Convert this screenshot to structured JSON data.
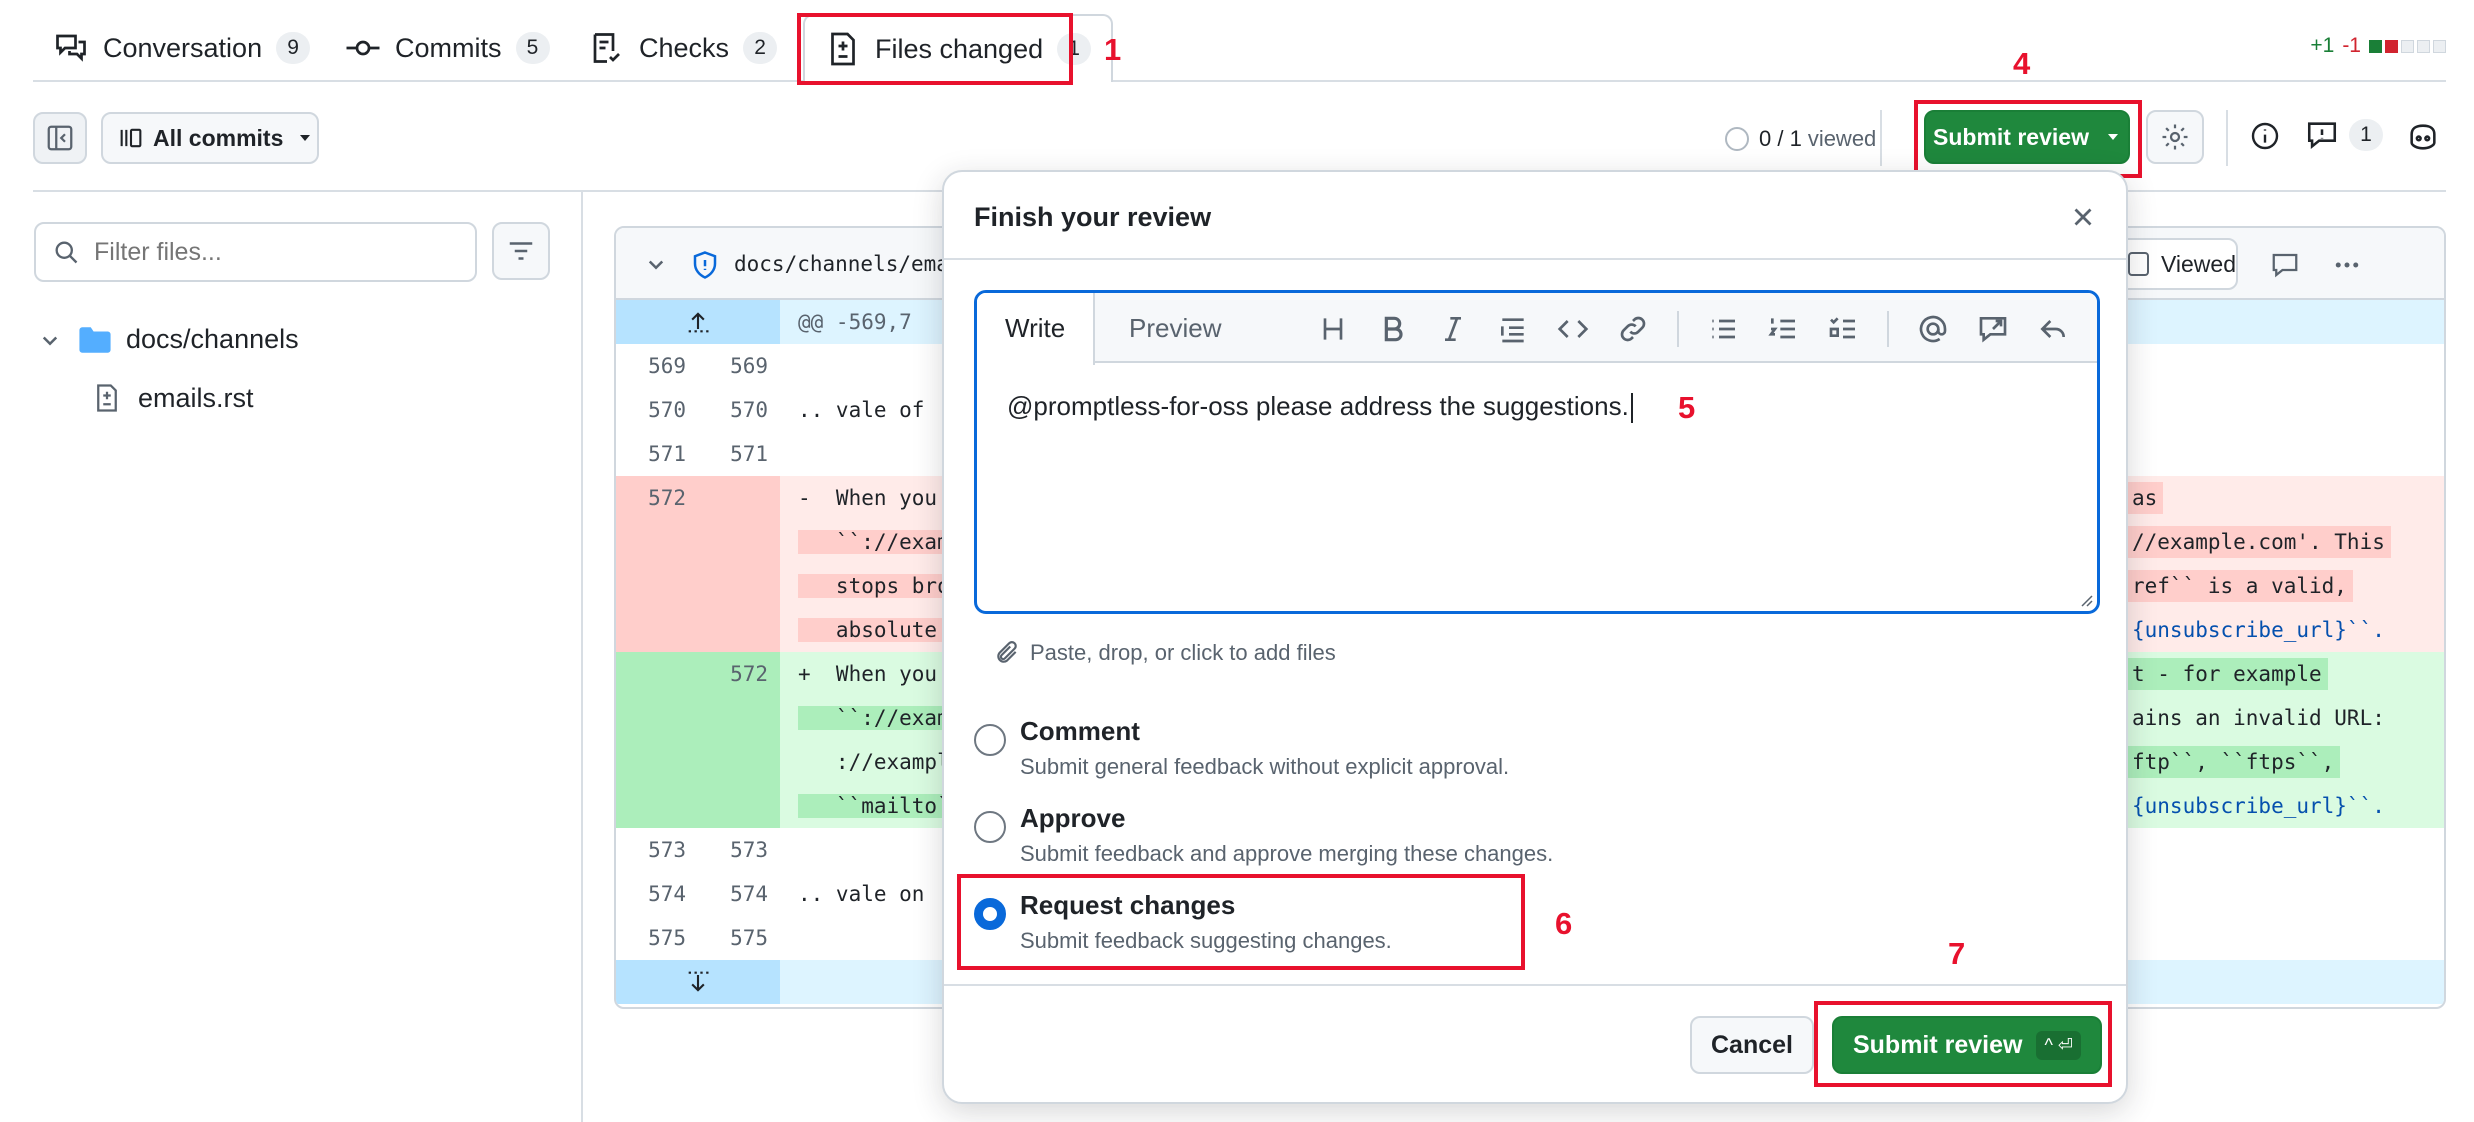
{
  "tabs": [
    {
      "label": "Conversation",
      "count": "9",
      "icon": "comment-discussion-icon"
    },
    {
      "label": "Commits",
      "count": "5",
      "icon": "git-commit-icon"
    },
    {
      "label": "Checks",
      "count": "2",
      "icon": "checklist-icon"
    },
    {
      "label": "Files changed",
      "count": "1",
      "icon": "file-diff-icon",
      "active": true
    }
  ],
  "diffstat": {
    "added": "+1",
    "removed": "-1"
  },
  "toolbar": {
    "commits_select": "All commits",
    "viewed": "0 / 1",
    "viewed_label": "viewed",
    "submit_review": "Submit review",
    "comments_count": "1"
  },
  "sidebar": {
    "filter_placeholder": "Filter files...",
    "folder": "docs/channels",
    "file": "emails.rst"
  },
  "diff": {
    "file_path": "docs/channels/emai",
    "viewed_label": "Viewed",
    "hunk_header": "@@ -569,7",
    "lines": [
      {
        "old": "569",
        "new": "569",
        "left": "",
        "right": ""
      },
      {
        "old": "570",
        "new": "570",
        "left": ".. vale of",
        "right": ""
      },
      {
        "old": "571",
        "new": "571",
        "left": "",
        "right": ""
      },
      {
        "old": "572",
        "new": "",
        "left": "-  When you s",
        "right": "as"
      },
      {
        "old": "",
        "new": "",
        "left": "   ``://examp",
        "right": "//example.com'. This"
      },
      {
        "old": "",
        "new": "",
        "left": "   stops brok",
        "right": "ref`` is a valid,"
      },
      {
        "old": "",
        "new": "",
        "left": "   absolute U",
        "right": "{unsubscribe_url}``."
      },
      {
        "old": "",
        "new": "572",
        "left": "+  When you s",
        "right": "t - for example"
      },
      {
        "old": "",
        "new": "",
        "left": "   ``://examp",
        "right": "ains an invalid URL:"
      },
      {
        "old": "",
        "new": "",
        "left": "   ://example",
        "right": "ftp``, ``ftps``,"
      },
      {
        "old": "",
        "new": "",
        "left": "   ``mailto``",
        "right": "{unsubscribe_url}``."
      },
      {
        "old": "573",
        "new": "573",
        "left": "",
        "right": ""
      },
      {
        "old": "574",
        "new": "574",
        "left": ".. vale on",
        "right": ""
      },
      {
        "old": "575",
        "new": "575",
        "left": "",
        "right": ""
      }
    ]
  },
  "modal": {
    "title": "Finish your review",
    "tab_write": "Write",
    "tab_preview": "Preview",
    "text": "@promptless-for-oss please address the suggestions.",
    "attach_hint": "Paste, drop, or click to add files",
    "options": [
      {
        "title": "Comment",
        "desc": "Submit general feedback without explicit approval.",
        "checked": false
      },
      {
        "title": "Approve",
        "desc": "Submit feedback and approve merging these changes.",
        "checked": false
      },
      {
        "title": "Request changes",
        "desc": "Submit feedback suggesting changes.",
        "checked": true
      }
    ],
    "cancel": "Cancel",
    "submit": "Submit review",
    "shortcut": "^ ⏎"
  },
  "annotations": [
    "1",
    "4",
    "5",
    "6",
    "7"
  ],
  "colors": {
    "accent": "#0969da",
    "green": "#1f883d",
    "red_annotation": "#e8112d"
  }
}
